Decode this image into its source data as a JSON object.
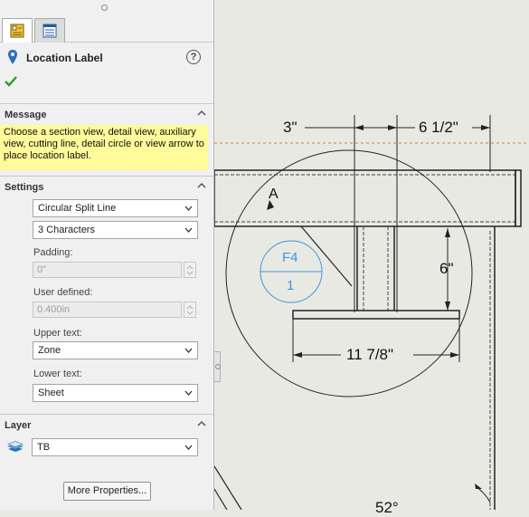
{
  "panel": {
    "title": "Location Label",
    "help_label": "?",
    "tabs": [
      {
        "name": "property-manager"
      },
      {
        "name": "feature-manager"
      }
    ],
    "message": {
      "header": "Message",
      "text": "Choose a section view, detail view, auxiliary view, cutting line, detail circle or view arrow to place location label."
    },
    "settings": {
      "header": "Settings",
      "style_select": "Circular Split Line",
      "characters_select": "3 Characters",
      "padding_label": "Padding:",
      "padding_value": "0\"",
      "user_defined_label": "User defined:",
      "user_defined_value": "0.400in",
      "upper_text_label": "Upper text:",
      "upper_text_value": "Zone",
      "lower_text_label": "Lower text:",
      "lower_text_value": "Sheet"
    },
    "layer": {
      "header": "Layer",
      "value": "TB"
    },
    "more_properties": "More Properties..."
  },
  "drawing": {
    "dimensions": [
      "3\"",
      "6 1/2\"",
      "6\"",
      "11 7/8\"",
      "52°"
    ],
    "detail_label": "A",
    "callout_upper": "F4",
    "callout_lower": "1"
  },
  "colors": {
    "accent": "#3f95dc",
    "message_bg": "#fffb9a",
    "check": "#2e9a2e",
    "centerline": "#e07a2e"
  }
}
